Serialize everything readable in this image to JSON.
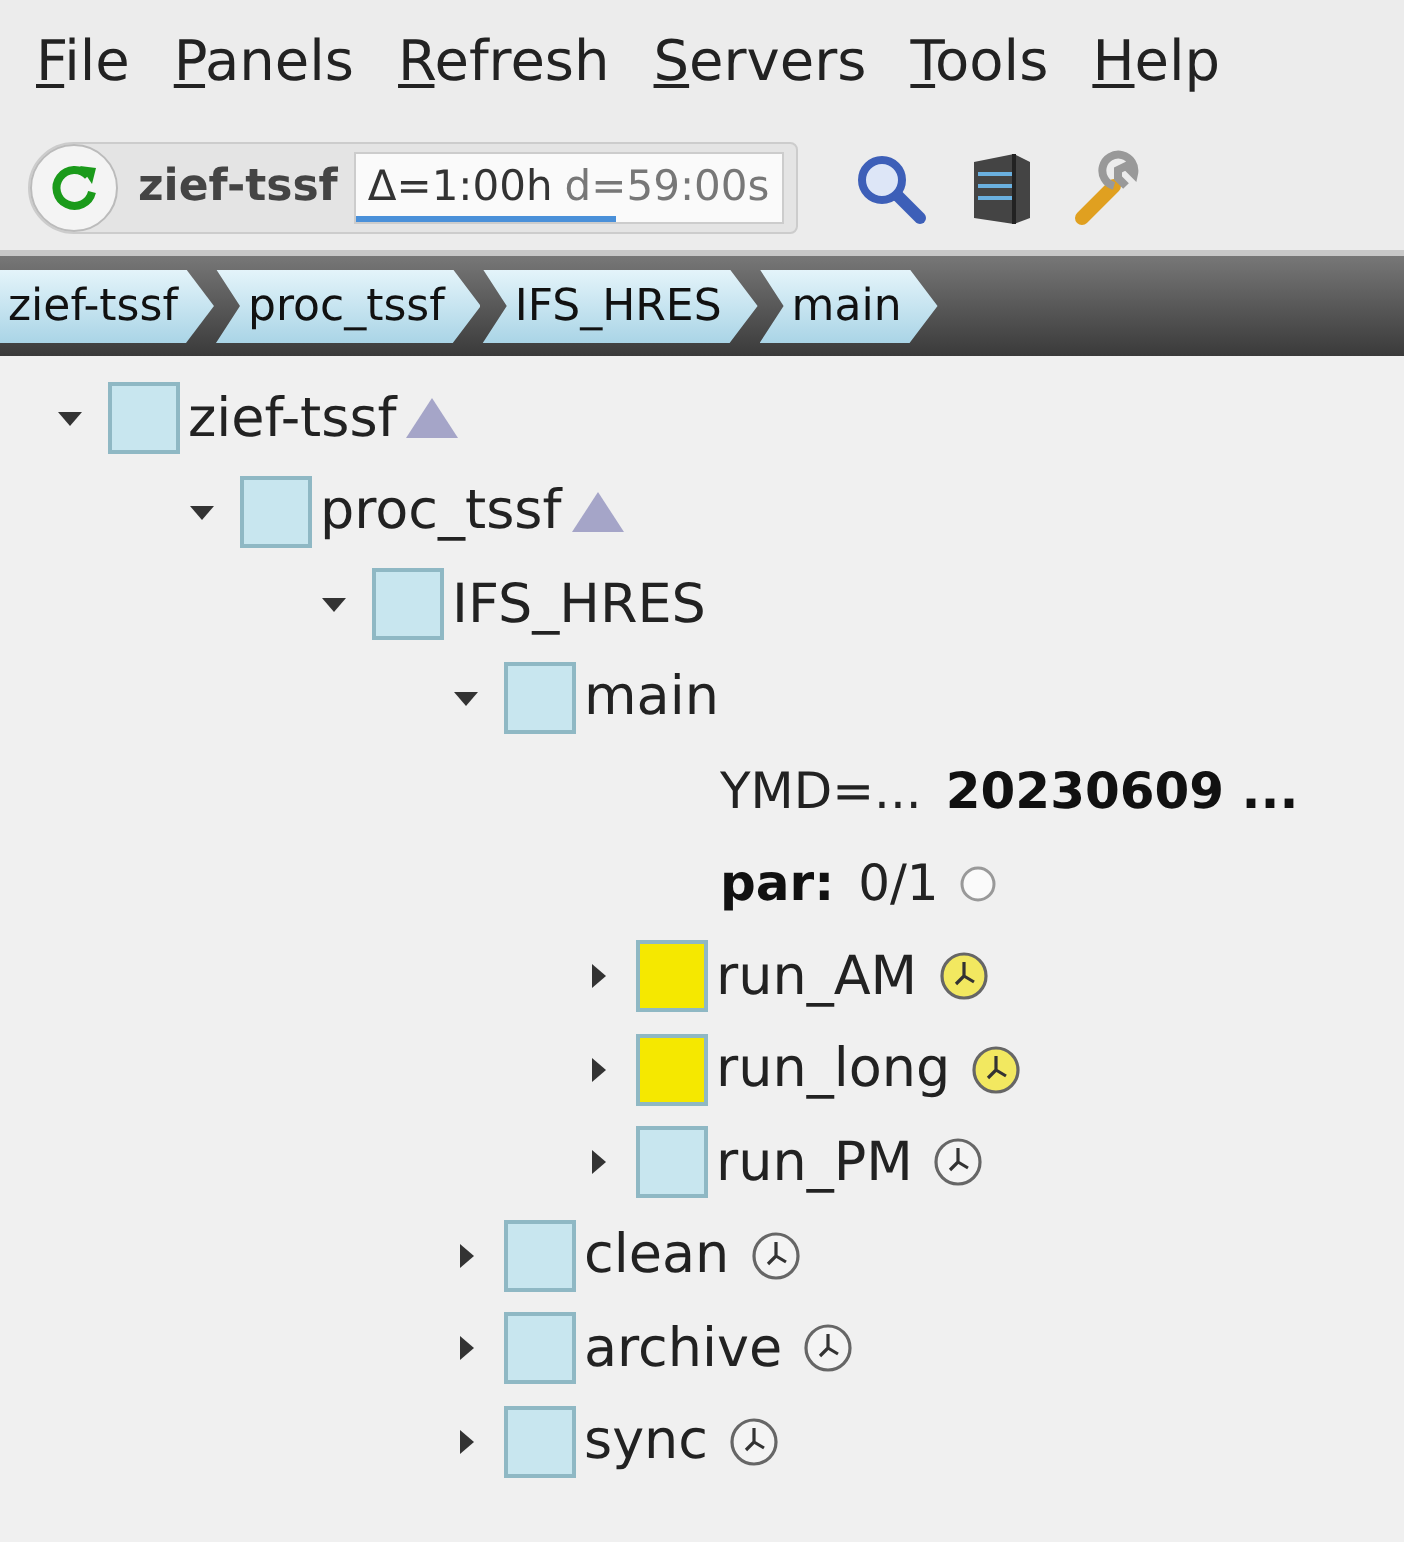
{
  "menu": [
    "File",
    "Panels",
    "Refresh",
    "Servers",
    "Tools",
    "Help"
  ],
  "toolbar": {
    "server": "zief-tssf",
    "interval": "Δ=1:00h",
    "countdown": "d=59:00s",
    "level": 0.61
  },
  "breadcrumb": [
    "zief-tssf",
    "proc_tssf",
    "IFS_HRES",
    "main"
  ],
  "tree": [
    {
      "kind": "node",
      "label": "zief-tssf",
      "color": "#c8e6ef",
      "expanded": true,
      "up_marker": true,
      "clock": false,
      "children": [
        {
          "kind": "node",
          "label": "proc_tssf",
          "color": "#c8e6ef",
          "expanded": true,
          "up_marker": true,
          "clock": false,
          "children": [
            {
              "kind": "node",
              "label": "IFS_HRES",
              "color": "#c8e6ef",
              "expanded": true,
              "up_marker": false,
              "clock": false,
              "children": [
                {
                  "kind": "node",
                  "label": "main",
                  "color": "#c8e6ef",
                  "expanded": true,
                  "up_marker": false,
                  "clock": false,
                  "children": [
                    {
                      "kind": "variable",
                      "name": "YMD=...",
                      "value": "20230609 ..."
                    },
                    {
                      "kind": "limit",
                      "name": "par:",
                      "value": "0/1"
                    },
                    {
                      "kind": "node",
                      "label": "run_AM",
                      "color": "#f5e800",
                      "expanded": false,
                      "up_marker": false,
                      "clock": true
                    },
                    {
                      "kind": "node",
                      "label": "run_long",
                      "color": "#f5e800",
                      "expanded": false,
                      "up_marker": false,
                      "clock": true
                    },
                    {
                      "kind": "node",
                      "label": "run_PM",
                      "color": "#c8e6ef",
                      "expanded": false,
                      "up_marker": false,
                      "clock": true
                    }
                  ]
                },
                {
                  "kind": "node",
                  "label": "clean",
                  "color": "#c8e6ef",
                  "expanded": false,
                  "up_marker": false,
                  "clock": true
                },
                {
                  "kind": "node",
                  "label": "archive",
                  "color": "#c8e6ef",
                  "expanded": false,
                  "up_marker": false,
                  "clock": true
                },
                {
                  "kind": "node",
                  "label": "sync",
                  "color": "#c8e6ef",
                  "expanded": false,
                  "up_marker": false,
                  "clock": true
                }
              ]
            }
          ]
        }
      ]
    }
  ]
}
